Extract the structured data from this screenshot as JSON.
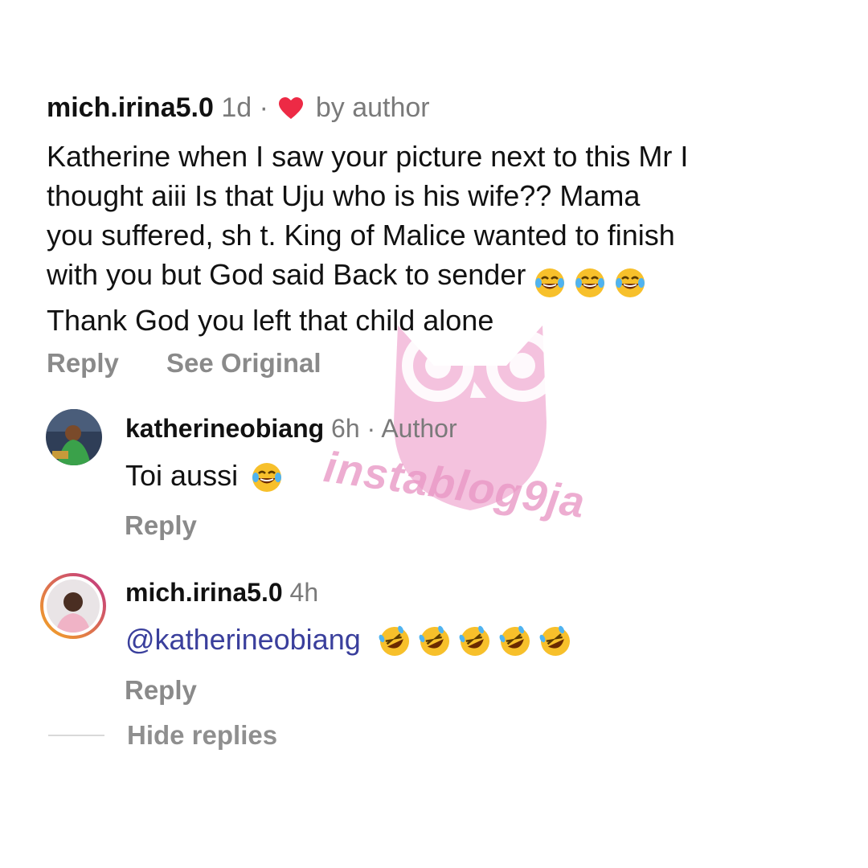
{
  "main_comment": {
    "username": "mich.irina5.0",
    "time": "1d",
    "separator": "·",
    "liked_label": "by author",
    "text_lines": [
      "Katherine when I saw your picture next to this Mr I",
      "thought aiii Is that Uju who is his wife?? Mama",
      "you suffered, sh  t. King of Malice wanted to finish",
      "with you but God said Back to sender",
      "Thank God you left that child alone"
    ],
    "emojis_line4": [
      "face-with-tears-of-joy",
      "face-with-tears-of-joy",
      "face-with-tears-of-joy"
    ],
    "reply_label": "Reply",
    "see_original_label": "See Original"
  },
  "replies": [
    {
      "username": "katherineobiang",
      "time": "6h",
      "separator": "·",
      "badge": "Author",
      "text": "Toi aussi",
      "emojis": [
        "face-with-tears-of-joy"
      ],
      "reply_label": "Reply"
    },
    {
      "username": "mich.irina5.0",
      "time": "4h",
      "mention": "@katherineobiang",
      "emojis": [
        "rolling-on-the-floor-laughing",
        "rolling-on-the-floor-laughing",
        "rolling-on-the-floor-laughing",
        "rolling-on-the-floor-laughing",
        "rolling-on-the-floor-laughing"
      ],
      "reply_label": "Reply"
    }
  ],
  "hide_replies_label": "Hide replies",
  "watermark_text": "instablog9ja",
  "colors": {
    "heart": "#ed2a45",
    "muted_text": "#7a7a7a",
    "action_text": "#8a8a8a",
    "mention": "#3a3f9c",
    "watermark": "#f1b6d6",
    "story_ring_start": "#c13584",
    "story_ring_end": "#f5a623"
  }
}
